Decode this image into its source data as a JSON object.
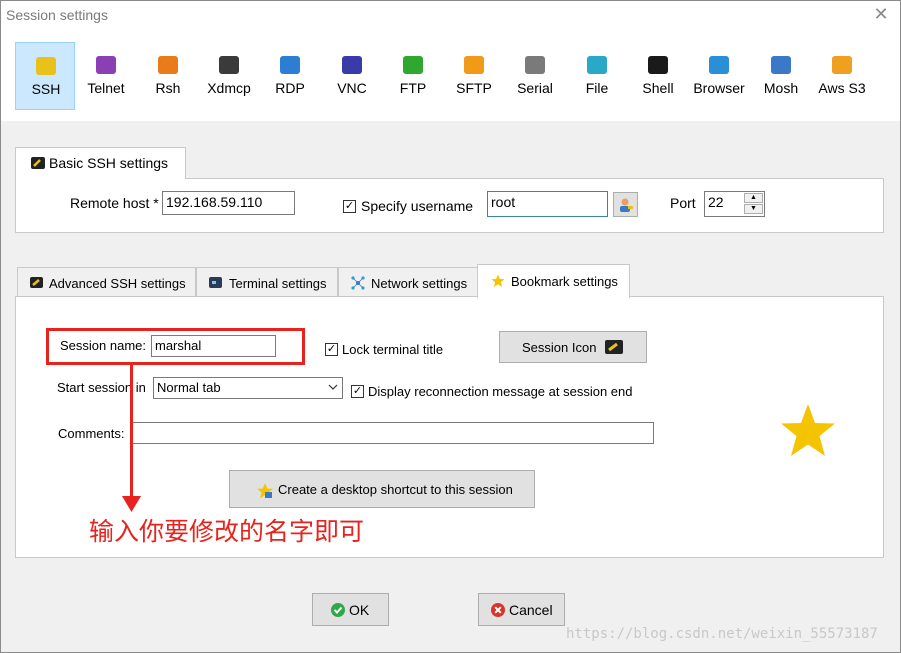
{
  "window": {
    "title": "Session settings",
    "close_glyph": "✕"
  },
  "protocols": [
    {
      "label": "SSH",
      "icon": "key-icon",
      "color": "#e8c21a",
      "selected": true
    },
    {
      "label": "Telnet",
      "icon": "telnet-icon",
      "color": "#8a3fb5"
    },
    {
      "label": "Rsh",
      "icon": "rsh-icon",
      "color": "#e87b1a"
    },
    {
      "label": "Xdmcp",
      "icon": "xdmcp-icon",
      "color": "#3a3a3a"
    },
    {
      "label": "RDP",
      "icon": "rdp-icon",
      "color": "#2d7dd2"
    },
    {
      "label": "VNC",
      "icon": "vnc-icon",
      "color": "#3a3aa8"
    },
    {
      "label": "FTP",
      "icon": "ftp-icon",
      "color": "#2ea82e"
    },
    {
      "label": "SFTP",
      "icon": "sftp-icon",
      "color": "#f09a18"
    },
    {
      "label": "Serial",
      "icon": "serial-icon",
      "color": "#7a7a7a"
    },
    {
      "label": "File",
      "icon": "file-icon",
      "color": "#2aa8c8"
    },
    {
      "label": "Shell",
      "icon": "shell-icon",
      "color": "#1a1a1a"
    },
    {
      "label": "Browser",
      "icon": "browser-icon",
      "color": "#2a8fd6"
    },
    {
      "label": "Mosh",
      "icon": "mosh-icon",
      "color": "#3a78c8"
    },
    {
      "label": "Aws S3",
      "icon": "aws-s3-icon",
      "color": "#f0a020"
    }
  ],
  "basic": {
    "tab_label": "Basic SSH settings",
    "remote_host_label": "Remote host *",
    "remote_host_value": "192.168.59.110",
    "specify_username_label": "Specify username",
    "specify_username_checked": "✓",
    "username_value": "root",
    "port_label": "Port",
    "port_value": "22"
  },
  "tabs": [
    {
      "label": "Advanced SSH settings",
      "icon": "key-icon"
    },
    {
      "label": "Terminal settings",
      "icon": "terminal-icon"
    },
    {
      "label": "Network settings",
      "icon": "network-icon"
    },
    {
      "label": "Bookmark settings",
      "icon": "star-icon",
      "active": true
    }
  ],
  "bookmark": {
    "session_name_label": "Session name:",
    "session_name_value": "marshal",
    "lock_terminal_label": "Lock terminal title",
    "lock_terminal_checked": "✓",
    "session_icon_label": "Session Icon",
    "start_session_label": "Start session in",
    "start_session_value": "Normal tab",
    "display_reconnect_label": "Display reconnection message at session end",
    "display_reconnect_checked": "✓",
    "comments_label": "Comments:",
    "comments_value": "",
    "shortcut_label": "Create a desktop shortcut to this session"
  },
  "annotation": {
    "text": "输入你要修改的名字即可"
  },
  "buttons": {
    "ok_label": "OK",
    "cancel_label": "Cancel"
  },
  "watermark": "https://blog.csdn.net/weixin_55573187",
  "colors": {
    "selected_bg": "#cce8ff",
    "annotation_red": "#e8231d",
    "star": "#f5c400"
  }
}
